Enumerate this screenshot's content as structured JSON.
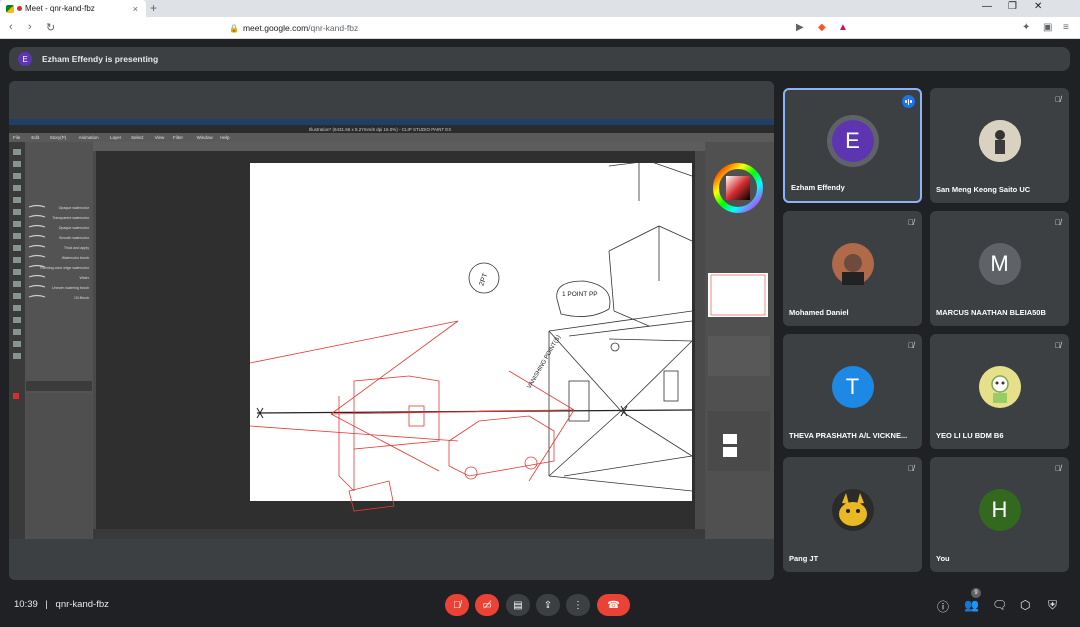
{
  "browser": {
    "tab_title": "Meet - qnr-kand-fbz",
    "tab_close": "×",
    "new_tab": "+",
    "url_host": "meet.google.com",
    "url_path": "/qnr-kand-fbz",
    "minimize": "—",
    "restore": "❐",
    "close": "✕"
  },
  "presenting_banner": {
    "avatar_letter": "E",
    "text": "Ezham Effendy is presenting"
  },
  "participants": [
    {
      "name": "Ezham Effendy",
      "initial": "E",
      "color": "#5e35b1",
      "speaking": true
    },
    {
      "name": "San Meng Keong Saito UC",
      "initial": "",
      "color": "#d9d2c0",
      "muted": true
    },
    {
      "name": "Mohamed Daniel",
      "initial": "",
      "color": "#9e5a3c",
      "muted": true
    },
    {
      "name": "MARCUS NAATHAN BLEIA50B",
      "initial": "M",
      "color": "#5f6368",
      "muted": true
    },
    {
      "name": "THEVA PRASHATH A/L VICKNE...",
      "initial": "T",
      "color": "#1e88e5",
      "muted": true
    },
    {
      "name": "YEO LI LU BDM B6",
      "initial": "",
      "color": "#e6e08a",
      "muted": true
    },
    {
      "name": "Pang JT",
      "initial": "",
      "color": "#d4a017",
      "muted": true
    },
    {
      "name": "You",
      "initial": "H",
      "color": "#33691e",
      "muted": true
    }
  ],
  "meeting": {
    "time": "10:39",
    "separator": "|",
    "code": "qnr-kand-fbz",
    "people_count": "9"
  },
  "shared_screen": {
    "app_title": "Illustration* (6431.66 x 8.27mm/6 dpi 16.0%) - CLIP STUDIO PAINT EX",
    "menu": [
      "File",
      "Edit",
      "Story(P)",
      "Animation",
      "Layer",
      "Select",
      "View",
      "Filter",
      "Window",
      "Help"
    ],
    "brushes": [
      "Opaque watercolor",
      "Transparent watercolor",
      "Opaque watercolor",
      "Smooth watercolor",
      "Thick and apply",
      "Watercolor brush",
      "Running color edge watercolor",
      "Water",
      "Uneven watering brush",
      "Oil Brush"
    ],
    "sketch_notes": [
      "2PT",
      "1 POINT PP",
      "VANISHING POINT(S)"
    ]
  },
  "colors": {
    "accent_blue": "#8ab4f8",
    "end_call": "#ea4335",
    "mic_off": "#ea4335"
  }
}
